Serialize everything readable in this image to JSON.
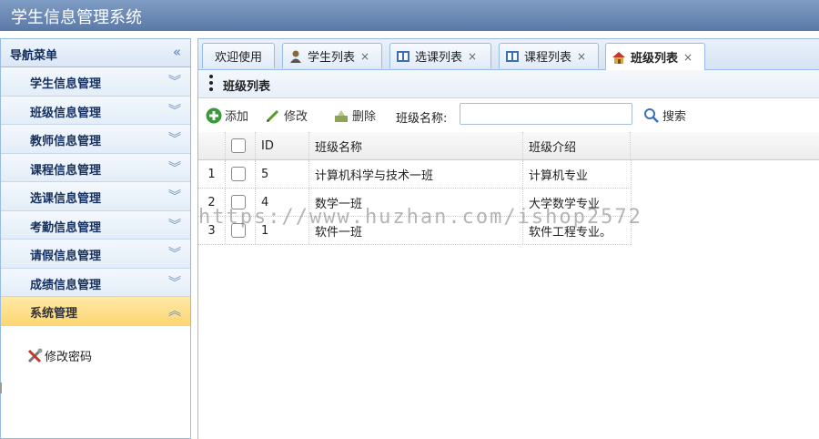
{
  "app": {
    "title": "学生信息管理系统"
  },
  "sidebar": {
    "header": "导航菜单",
    "collapse_icon": "double-chevron-left-icon",
    "items": [
      {
        "label": "学生信息管理"
      },
      {
        "label": "班级信息管理"
      },
      {
        "label": "教师信息管理"
      },
      {
        "label": "课程信息管理"
      },
      {
        "label": "选课信息管理"
      },
      {
        "label": "考勤信息管理"
      },
      {
        "label": "请假信息管理"
      },
      {
        "label": "成绩信息管理"
      },
      {
        "label": "系统管理",
        "active": true
      }
    ],
    "sub_items": [
      {
        "label": "修改密码",
        "icon": "tools-icon"
      }
    ]
  },
  "tabs": [
    {
      "label": "欢迎使用",
      "closable": false
    },
    {
      "label": "学生列表",
      "icon": "user-icon",
      "closable": true
    },
    {
      "label": "选课列表",
      "icon": "book-icon",
      "closable": true
    },
    {
      "label": "课程列表",
      "icon": "book-icon",
      "closable": true
    },
    {
      "label": "班级列表",
      "icon": "home-icon",
      "closable": true,
      "active": true
    }
  ],
  "close_glyph": "×",
  "panel": {
    "title": "班级列表"
  },
  "toolbar": {
    "add_label": "添加",
    "edit_label": "修改",
    "delete_label": "删除",
    "search_label": "班级名称:",
    "search_value": "",
    "search_button_label": "搜索"
  },
  "grid": {
    "columns": [
      "ID",
      "班级名称",
      "班级介绍"
    ],
    "rows": [
      {
        "num": "1",
        "id": "5",
        "name": "计算机科学与技术一班",
        "intro": "计算机专业"
      },
      {
        "num": "2",
        "id": "4",
        "name": "数学一班",
        "intro": "大学数学专业"
      },
      {
        "num": "3",
        "id": "1",
        "name": "软件一班",
        "intro": "软件工程专业。"
      }
    ]
  },
  "watermark": "https://www.huzhan.com/ishop2572",
  "colors": {
    "accent": "#5a79a6",
    "active_menu": "#fcd671",
    "border": "#99bbe8"
  }
}
